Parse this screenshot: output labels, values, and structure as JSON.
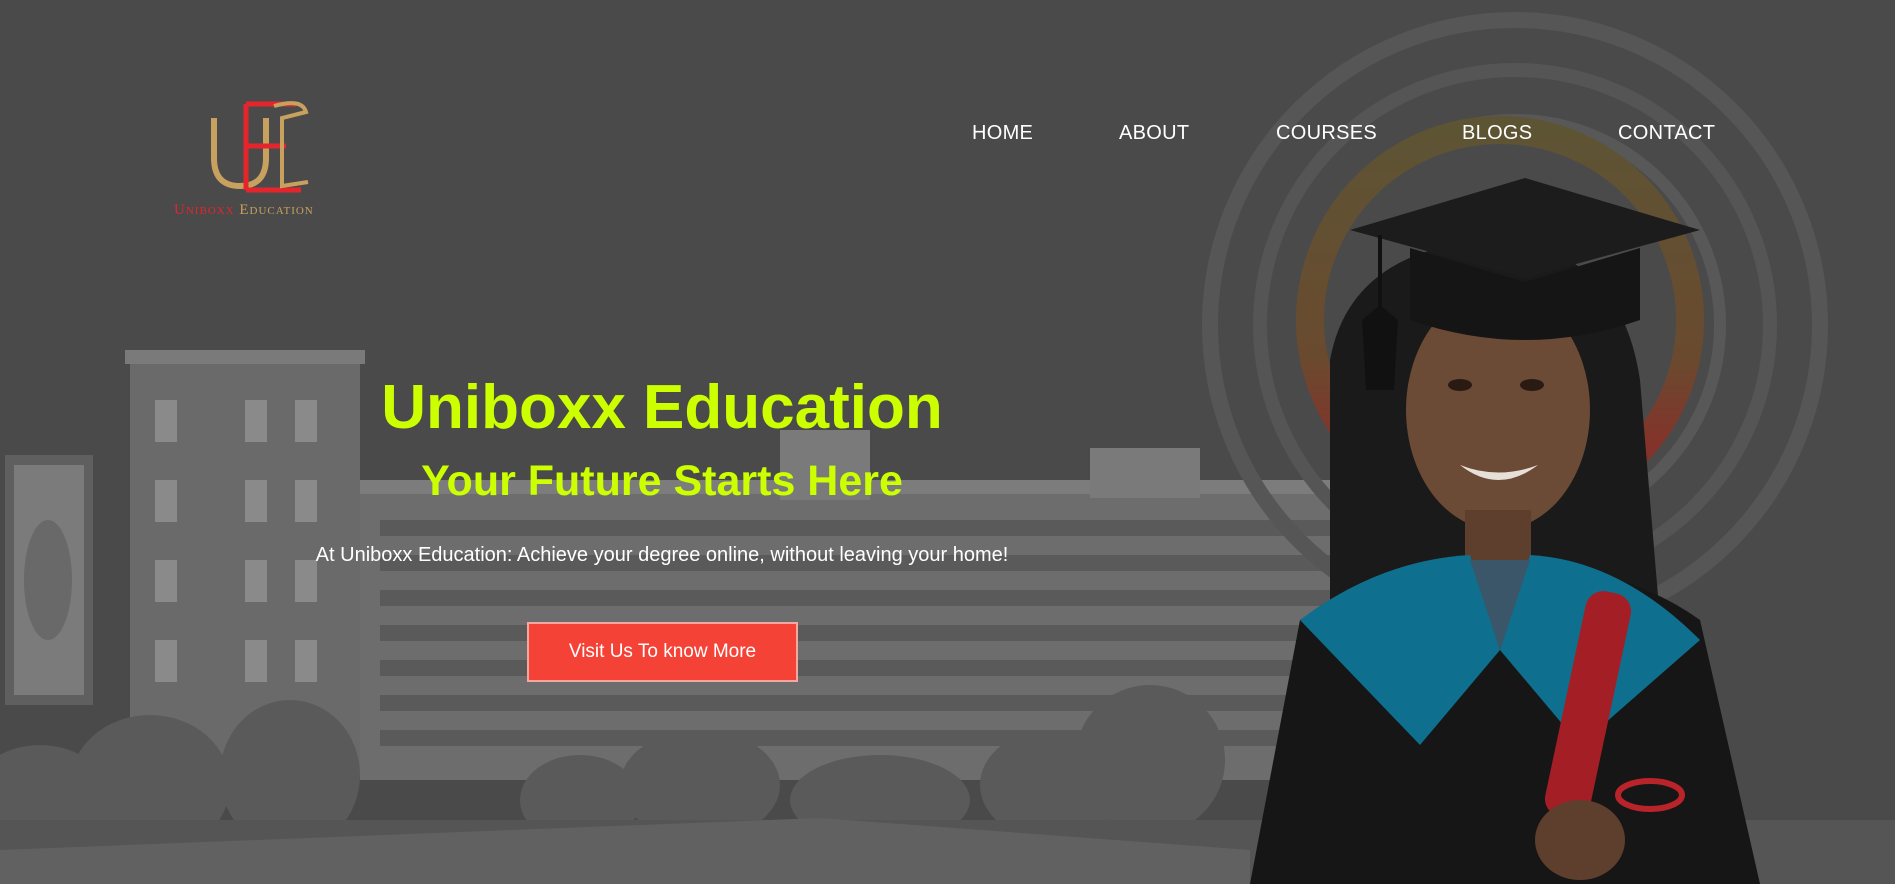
{
  "brand": {
    "logo_monogram": "UE",
    "logo_name_part1": "Uniboxx",
    "logo_name_part2": "Education",
    "colors": {
      "red": "#e4252b",
      "gold": "#c8a15e"
    }
  },
  "nav": {
    "items": [
      {
        "label": "HOME"
      },
      {
        "label": "ABOUT"
      },
      {
        "label": "COURSES"
      },
      {
        "label": "BLOGS"
      },
      {
        "label": "CONTACT"
      }
    ]
  },
  "hero": {
    "title": "Uniboxx Education",
    "subtitle": "Your Future Starts Here",
    "description": "At Uniboxx Education: Achieve your degree online, without leaving your home!",
    "cta_label": "Visit Us To know More",
    "colors": {
      "headline": "#ccff00",
      "cta": "#f44336",
      "overlay": "#4a4a4a"
    }
  }
}
